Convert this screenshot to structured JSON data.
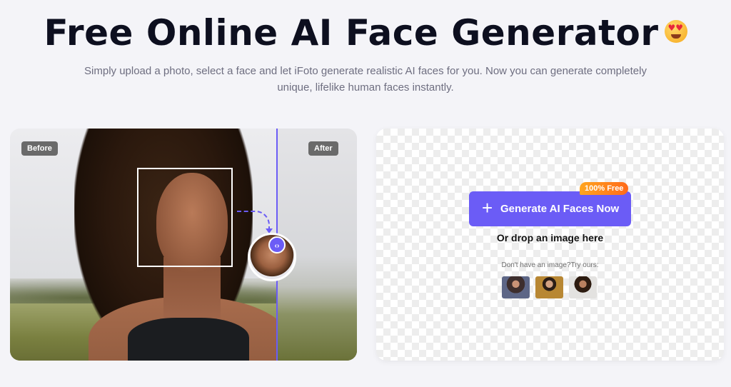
{
  "header": {
    "title": "Free Online AI Face Generator",
    "emoji_icon": "heart-eyes-emoji-icon",
    "subtitle": "Simply upload a photo, select a face and let iFoto generate realistic AI faces for you. Now you can generate completely unique, lifelike human faces instantly."
  },
  "compare": {
    "before_label": "Before",
    "after_label": "After",
    "handle_icon": "code-arrows-icon",
    "accent_color": "#6b5cf6"
  },
  "upload": {
    "button_label": "Generate AI Faces Now",
    "button_icon": "plus-icon",
    "free_tag": "100% Free",
    "drop_text": "Or drop an image here",
    "try_text": "Don't have an image?Try ours:",
    "samples": [
      "sample-face-1",
      "sample-face-2",
      "sample-face-3"
    ],
    "button_color": "#6b5cf6",
    "tag_color": "#ff8a1a"
  }
}
